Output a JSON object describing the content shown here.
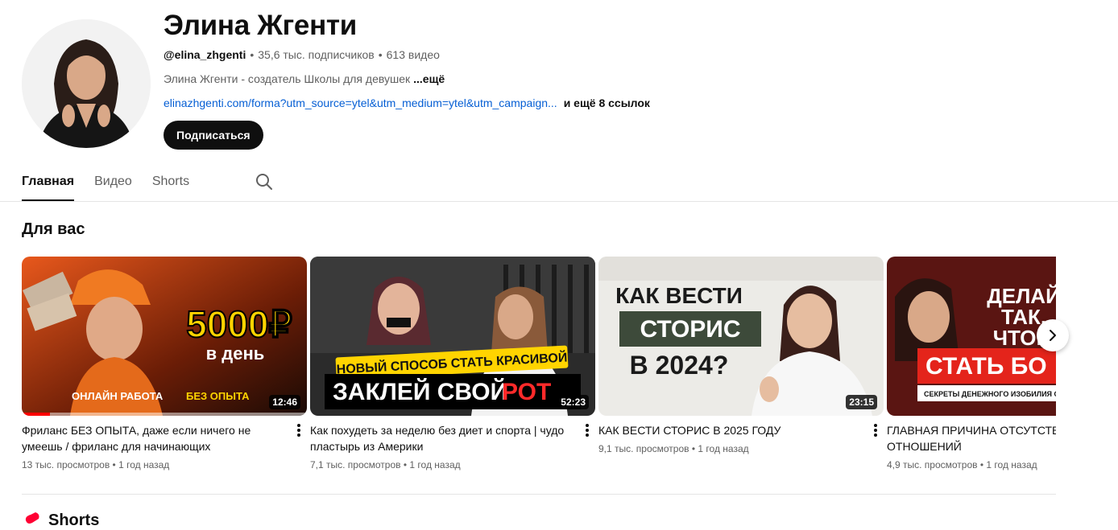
{
  "channel": {
    "name": "Элина Жгенти",
    "handle": "@elina_zhgenti",
    "subscribers": "35,6 тыс. подписчиков",
    "videos_count": "613 видео",
    "meta_sep": "•",
    "description": "Элина Жгенти - создатель Школы для девушек",
    "description_more": "...ещё",
    "link": "elinazhgenti.com/forma?utm_source=ytel&utm_medium=ytel&utm_campaign...",
    "more_links": "и ещё 8 ссылок",
    "subscribe_label": "Подписаться"
  },
  "tabs": [
    {
      "label": "Главная",
      "active": true
    },
    {
      "label": "Видео",
      "active": false
    },
    {
      "label": "Shorts",
      "active": false
    }
  ],
  "section": {
    "title": "Для вас"
  },
  "videos": [
    {
      "title": "Фриланс БЕЗ ОПЫТА, даже если ничего не умеешь / фриланс для начинающих",
      "views": "13 тыс. просмотров",
      "age": "1 год назад",
      "duration": "12:46",
      "watched_fraction": 0.1,
      "thumb_text": [
        "5000₽",
        "в день",
        "ОНЛАЙН РАБОТА",
        "БЕЗ ОПЫТА"
      ]
    },
    {
      "title": "Как похудеть за неделю без диет и спорта | чудо пластырь из Америки",
      "views": "7,1 тыс. просмотров",
      "age": "1 год назад",
      "duration": "52:23",
      "thumb_text": [
        "НОВЫЙ СПОСОБ СТАТЬ КРАСИВОЙ",
        "ЗАКЛЕЙ СВОЙ",
        "РОТ"
      ]
    },
    {
      "title": "КАК ВЕСТИ СТОРИС В 2025 ГОДУ",
      "views": "9,1 тыс. просмотров",
      "age": "1 год назад",
      "duration": "23:15",
      "thumb_text": [
        "КАК ВЕСТИ",
        "СТОРИС",
        "В 2024?"
      ]
    },
    {
      "title": "ГЛАВНАЯ ПРИЧИНА ОТСУТСТВИЯ ОТНОШЕНИЙ",
      "views": "4,9 тыс. просмотров",
      "age": "1 год назад",
      "duration": "",
      "thumb_text": [
        "ДЕЛАЙ",
        "ТАК,",
        "ЧТОБ",
        "СТАТЬ БО",
        "СЕКРЕТЫ ДЕНЕЖНОГО ИЗОБИЛИЯ С"
      ]
    }
  ],
  "next_section": {
    "title": "Shorts"
  },
  "icons": {
    "search": "search-icon",
    "kebab": "more-vert-icon",
    "next": "chevron-right-icon",
    "shorts": "shorts-logo-icon"
  },
  "colors": {
    "accent": "#065fd4",
    "subscribe_bg": "#0f0f0f",
    "progress": "#ff0000"
  }
}
